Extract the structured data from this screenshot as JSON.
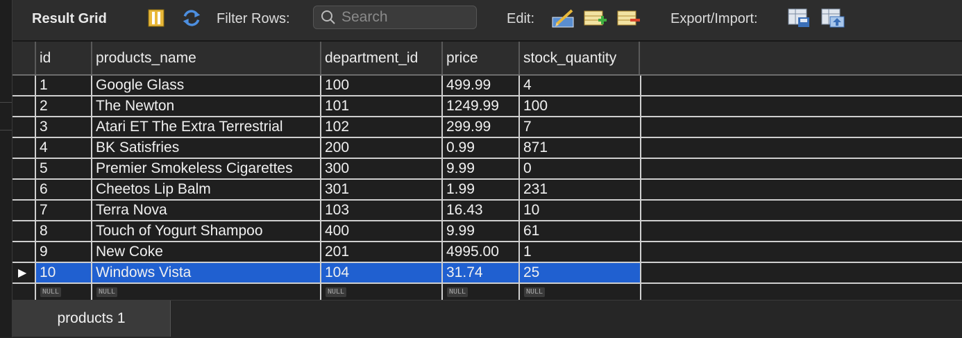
{
  "toolbar": {
    "title": "Result Grid",
    "filter_label": "Filter Rows:",
    "search_placeholder": "Search",
    "edit_label": "Edit:",
    "export_label": "Export/Import:"
  },
  "grid": {
    "columns": [
      "id",
      "products_name",
      "department_id",
      "price",
      "stock_quantity"
    ],
    "rows": [
      [
        "1",
        "Google Glass",
        "100",
        "499.99",
        "4"
      ],
      [
        "2",
        "The Newton",
        "101",
        "1249.99",
        "100"
      ],
      [
        "3",
        "Atari ET The Extra Terrestrial",
        "102",
        "299.99",
        "7"
      ],
      [
        "4",
        "BK Satisfries",
        "200",
        "0.99",
        "871"
      ],
      [
        "5",
        "Premier Smokeless Cigarettes",
        "300",
        "9.99",
        "0"
      ],
      [
        "6",
        "Cheetos Lip Balm",
        "301",
        "1.99",
        "231"
      ],
      [
        "7",
        "Terra Nova",
        "103",
        "16.43",
        "10"
      ],
      [
        "8",
        "Touch of Yogurt Shampoo",
        "400",
        "9.99",
        "61"
      ],
      [
        "9",
        "New Coke",
        "201",
        "4995.00",
        "1"
      ],
      [
        "10",
        "Windows Vista",
        "104",
        "31.74",
        "25"
      ]
    ],
    "null_label": "NULL",
    "selected_row_index": 9,
    "selection_color": "#2060d0"
  },
  "tabs": {
    "active": "products 1"
  }
}
